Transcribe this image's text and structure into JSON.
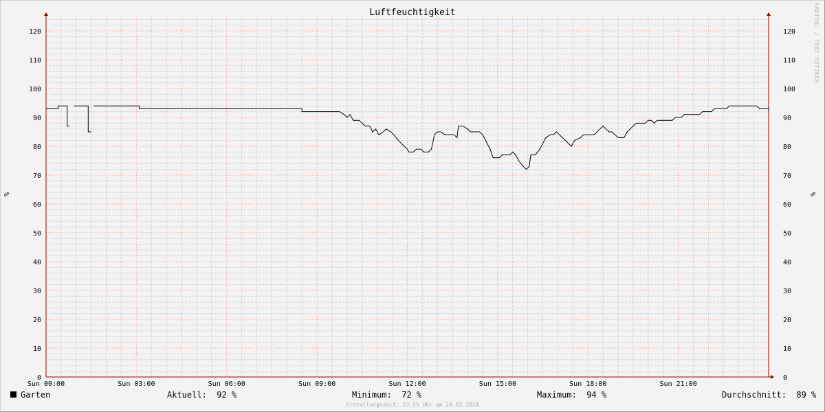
{
  "title": "Luftfeuchtigkeit",
  "watermark": "RRDTOOL / TOBI OETIKER",
  "unit_left": "%",
  "unit_right": "%",
  "legend": {
    "series_name": "Garten",
    "current_label": "Aktuell:",
    "current_value": "92 %",
    "min_label": "Minimum:",
    "min_value": "72 %",
    "max_label": "Maximum:",
    "max_value": "94 %",
    "avg_label": "Durchschnitt:",
    "avg_value": "89 %"
  },
  "footer": "Erstellungszeit: 23:55 Uhr am 24.03.2024",
  "colors": {
    "line": "#000000",
    "major_grid": "#ff9999",
    "minor_grid": "#cccccc",
    "axis": "#990000"
  },
  "chart_data": {
    "type": "line",
    "title": "Luftfeuchtigkeit",
    "xlabel": "",
    "ylabel": "%",
    "xlim": [
      0,
      24
    ],
    "ylim": [
      0,
      125
    ],
    "x_ticks": [
      0,
      3,
      6,
      9,
      12,
      15,
      18,
      21
    ],
    "x_tick_labels": [
      "Sun 00:00",
      "Sun 03:00",
      "Sun 06:00",
      "Sun 09:00",
      "Sun 12:00",
      "Sun 15:00",
      "Sun 18:00",
      "Sun 21:00"
    ],
    "y_ticks": [
      0,
      10,
      20,
      30,
      40,
      50,
      60,
      70,
      80,
      90,
      100,
      110,
      120
    ],
    "grid": true,
    "series": [
      {
        "name": "Garten",
        "segments": [
          [
            [
              0,
              93
            ],
            [
              0.4,
              93
            ],
            [
              0.4,
              94
            ],
            [
              0.7,
              94
            ],
            [
              0.7,
              87
            ],
            [
              0.78,
              87
            ]
          ],
          [
            [
              0.93,
              94
            ],
            [
              1.4,
              94
            ],
            [
              1.4,
              85
            ],
            [
              1.5,
              85
            ]
          ],
          [
            [
              1.58,
              94
            ],
            [
              3.1,
              94
            ],
            [
              3.1,
              93
            ],
            [
              8.5,
              93
            ],
            [
              8.5,
              92
            ],
            [
              9.75,
              92
            ],
            [
              9.9,
              91
            ],
            [
              10,
              90
            ],
            [
              10.1,
              91
            ],
            [
              10.2,
              89
            ],
            [
              10.4,
              89
            ],
            [
              10.5,
              88
            ],
            [
              10.6,
              87
            ],
            [
              10.75,
              87
            ],
            [
              10.85,
              85
            ],
            [
              10.95,
              86
            ],
            [
              11.05,
              84
            ],
            [
              11.2,
              85
            ],
            [
              11.3,
              86
            ],
            [
              11.45,
              85
            ],
            [
              11.55,
              84
            ],
            [
              11.7,
              82
            ],
            [
              11.8,
              81
            ],
            [
              11.9,
              80
            ],
            [
              12.0,
              79
            ],
            [
              12.05,
              78
            ],
            [
              12.2,
              78
            ],
            [
              12.3,
              79
            ],
            [
              12.45,
              79
            ],
            [
              12.55,
              78
            ],
            [
              12.7,
              78
            ],
            [
              12.8,
              79
            ],
            [
              12.9,
              84
            ],
            [
              13.0,
              85
            ],
            [
              13.1,
              85
            ],
            [
              13.25,
              84
            ],
            [
              13.4,
              84
            ],
            [
              13.55,
              84
            ],
            [
              13.65,
              83
            ],
            [
              13.7,
              87
            ],
            [
              13.85,
              87
            ],
            [
              14.0,
              86
            ],
            [
              14.1,
              85
            ],
            [
              14.4,
              85
            ],
            [
              14.5,
              84
            ],
            [
              14.6,
              82
            ],
            [
              14.75,
              79
            ],
            [
              14.85,
              76
            ],
            [
              15.05,
              76
            ],
            [
              15.15,
              77
            ],
            [
              15.4,
              77
            ],
            [
              15.5,
              78
            ],
            [
              15.6,
              77
            ],
            [
              15.7,
              75
            ],
            [
              15.85,
              73
            ],
            [
              15.95,
              72
            ],
            [
              16.05,
              73
            ],
            [
              16.1,
              77
            ],
            [
              16.25,
              77
            ],
            [
              16.4,
              79
            ],
            [
              16.5,
              81
            ],
            [
              16.6,
              83
            ],
            [
              16.75,
              84
            ],
            [
              16.85,
              84
            ],
            [
              16.95,
              85
            ],
            [
              17.05,
              84
            ],
            [
              17.15,
              83
            ],
            [
              17.25,
              82
            ],
            [
              17.35,
              81
            ],
            [
              17.45,
              80
            ],
            [
              17.55,
              82
            ],
            [
              17.75,
              83
            ],
            [
              17.85,
              84
            ],
            [
              18.2,
              84
            ],
            [
              18.3,
              85
            ],
            [
              18.4,
              86
            ],
            [
              18.5,
              87
            ],
            [
              18.6,
              86
            ],
            [
              18.7,
              85
            ],
            [
              18.8,
              85
            ],
            [
              18.9,
              84
            ],
            [
              19.0,
              83
            ],
            [
              19.2,
              83
            ],
            [
              19.3,
              85
            ],
            [
              19.4,
              86
            ],
            [
              19.5,
              87
            ],
            [
              19.6,
              88
            ],
            [
              19.9,
              88
            ],
            [
              20.0,
              89
            ],
            [
              20.1,
              89
            ],
            [
              20.2,
              88
            ],
            [
              20.3,
              89
            ],
            [
              20.8,
              89
            ],
            [
              20.9,
              90
            ],
            [
              21.1,
              90
            ],
            [
              21.2,
              91
            ],
            [
              21.7,
              91
            ],
            [
              21.8,
              92
            ],
            [
              22.1,
              92
            ],
            [
              22.2,
              93
            ],
            [
              22.6,
              93
            ],
            [
              22.7,
              94
            ],
            [
              23.6,
              94
            ],
            [
              23.7,
              93
            ],
            [
              24.7,
              93
            ],
            [
              24.8,
              94
            ],
            [
              25.4,
              94
            ],
            [
              25.5,
              93
            ],
            [
              25.85,
              93
            ],
            [
              25.95,
              92
            ],
            [
              26.0,
              92
            ]
          ]
        ]
      }
    ]
  }
}
